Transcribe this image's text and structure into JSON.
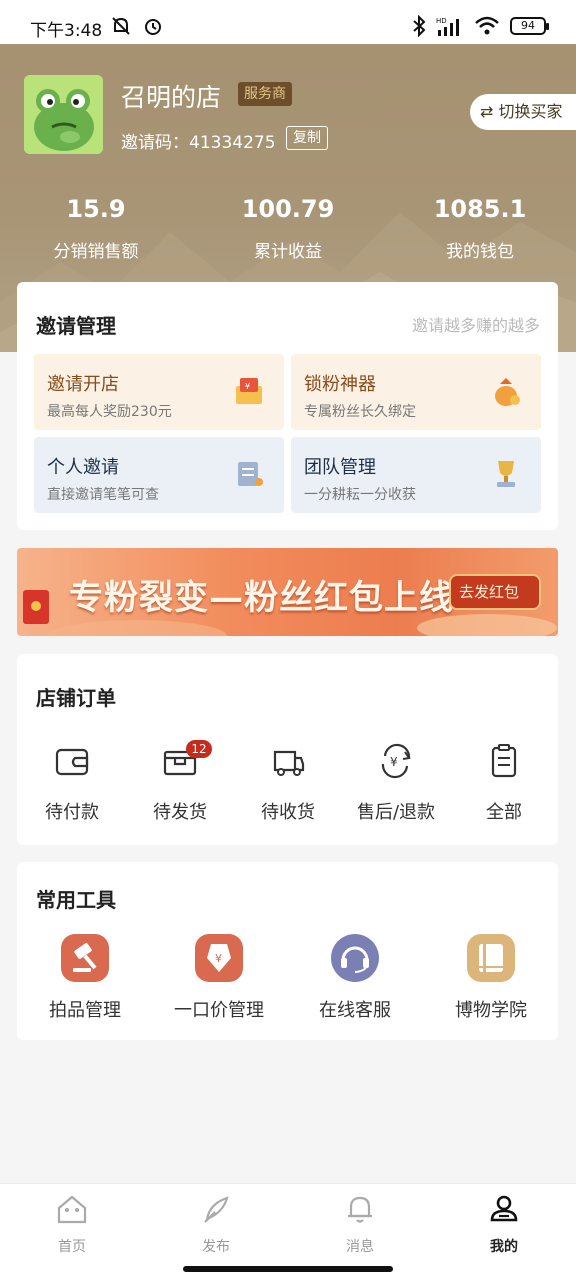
{
  "status_bar": {
    "time": "下午3:48",
    "battery": "94",
    "network": "HD"
  },
  "profile": {
    "shop_name": "召明的店",
    "badge": "服务商",
    "invite_code_label": "邀请码：41334275",
    "copy_label": "复制",
    "switch_label": "⇄ 切换买家"
  },
  "stats": [
    {
      "value": "15.9",
      "label": "分销销售额"
    },
    {
      "value": "100.79",
      "label": "累计收益"
    },
    {
      "value": "1085.1",
      "label": "我的钱包"
    }
  ],
  "invite": {
    "title": "邀请管理",
    "hint": "邀请越多赚的越多",
    "tiles": [
      {
        "title": "邀请开店",
        "subtitle": "最高每人奖励230元",
        "icon": "gift-envelope-icon"
      },
      {
        "title": "锁粉神器",
        "subtitle": "专属粉丝长久绑定",
        "icon": "money-bag-icon"
      },
      {
        "title": "个人邀请",
        "subtitle": "直接邀请笔笔可查",
        "icon": "scroll-icon"
      },
      {
        "title": "团队管理",
        "subtitle": "一分耕耘一分收获",
        "icon": "trophy-icon"
      }
    ]
  },
  "banner": {
    "text": "专粉裂变—粉丝红包上线",
    "button": "去发红包"
  },
  "orders": {
    "title": "店铺订单",
    "items": [
      {
        "label": "待付款",
        "icon": "wallet-icon"
      },
      {
        "label": "待发货",
        "icon": "box-icon",
        "badge": "12"
      },
      {
        "label": "待收货",
        "icon": "truck-icon"
      },
      {
        "label": "售后/退款",
        "icon": "refund-icon"
      },
      {
        "label": "全部",
        "icon": "clipboard-icon"
      }
    ]
  },
  "tools": {
    "title": "常用工具",
    "items": [
      {
        "label": "拍品管理",
        "icon": "gavel-icon",
        "color": "#d9694f"
      },
      {
        "label": "一口价管理",
        "icon": "price-tag-icon",
        "color": "#d9694f"
      },
      {
        "label": "在线客服",
        "icon": "headset-icon",
        "color": "#7a80b3"
      },
      {
        "label": "博物学院",
        "icon": "book-icon",
        "color": "#dbb57a"
      }
    ]
  },
  "tabbar": [
    {
      "label": "首页",
      "icon": "home-icon"
    },
    {
      "label": "发布",
      "icon": "publish-icon"
    },
    {
      "label": "消息",
      "icon": "bell-icon"
    },
    {
      "label": "我的",
      "icon": "user-icon",
      "active": true
    }
  ]
}
